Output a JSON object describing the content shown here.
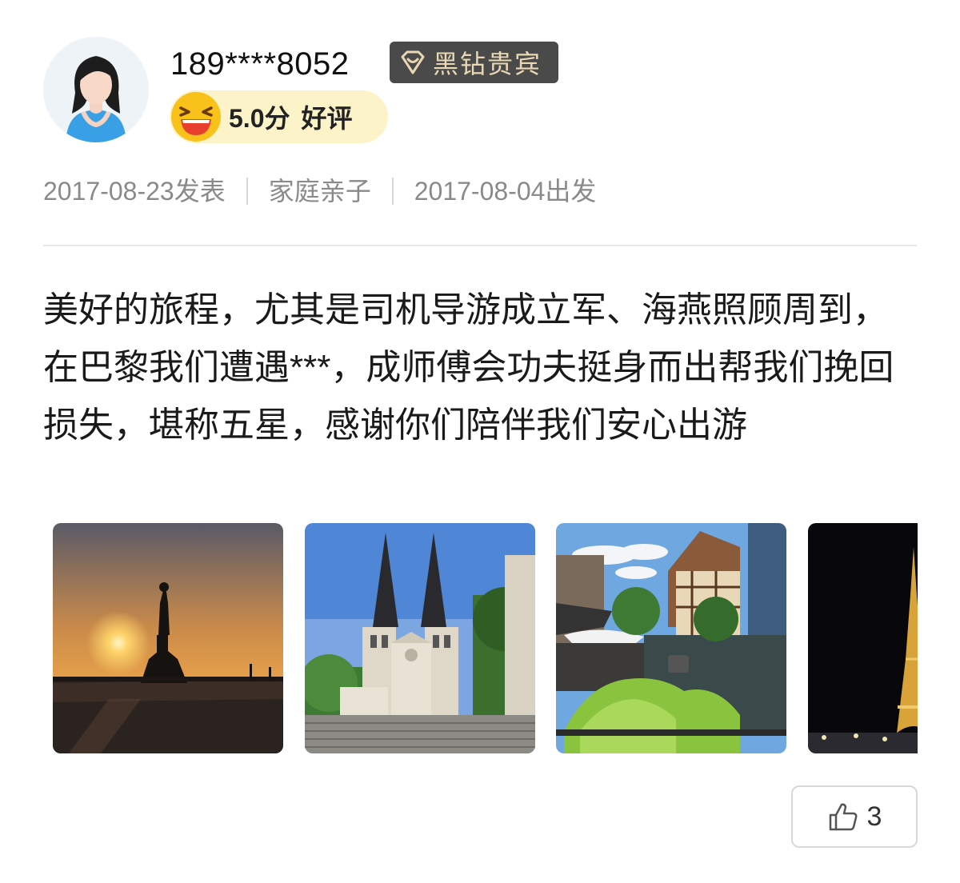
{
  "user": {
    "name": "189****8052",
    "vip_label": "黑钻贵宾",
    "rating_score": "5.0分",
    "rating_label": "好评"
  },
  "meta": {
    "published": "2017-08-23发表",
    "trip_type": "家庭亲子",
    "departure": "2017-08-04出发"
  },
  "review": {
    "text": "美好的旅程，尤其是司机导游成立军、海燕照顾周到，在巴黎我们遭遇***，成师傅会功夫挺身而出帮我们挽回损失，堪称五星，感谢你们陪伴我们安心出游"
  },
  "photos": [
    {
      "subject": "statue silhouette at sunset"
    },
    {
      "subject": "twin-spire church"
    },
    {
      "subject": "canal with timber houses"
    },
    {
      "subject": "Eiffel Tower at night"
    }
  ],
  "like": {
    "count": "3",
    "icon": "thumbs-up-icon"
  },
  "colors": {
    "vip_badge_bg": "#4a4a4a",
    "vip_text": "#ead7b3",
    "rating_pill_bg": "#fdf3c9",
    "meta_text": "#8a8a8a"
  }
}
